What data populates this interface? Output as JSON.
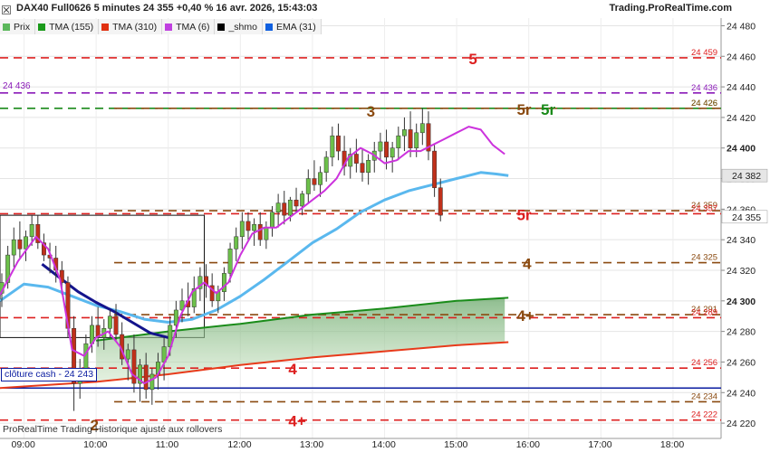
{
  "header": {
    "title": "DAX40 Full0626 5 minutes 24 355 +0,40 % 16 avr. 2026, 15:43:03",
    "brand": "Trading.ProRealTime.com"
  },
  "legend": [
    {
      "label": "Prix",
      "color": "#5cb85c"
    },
    {
      "label": "TMA (155)",
      "color": "#1a9a1a"
    },
    {
      "label": "TMA (310)",
      "color": "#e03010"
    },
    {
      "label": "TMA (6)",
      "color": "#c040e0"
    },
    {
      "label": "_shmo",
      "color": "#000000"
    },
    {
      "label": "EMA (31)",
      "color": "#1060e0"
    }
  ],
  "footer": "ProRealTime Trading  Historique ajusté aux rollovers",
  "cash": {
    "label": "clôture cash -  24 243",
    "value": 24243
  },
  "colors": {
    "bull": "#6cc04a",
    "bear": "#c0301a",
    "ema": "#5ab8ee",
    "tma6": "#cc33dd",
    "shmo": "#14148c",
    "tma155": "#1a8c1a",
    "tma310": "#e83a1a",
    "level_red": "#dd2020",
    "level_brown": "#8a4a10",
    "level_green": "#1a8a1a",
    "level_purple": "#8a1ab8",
    "cash_line": "#0a1ca0"
  },
  "chart_data": {
    "type": "candlestick",
    "title": "DAX40 Full0626 5 minutes",
    "xlabel": "",
    "ylabel": "",
    "ylim": [
      24210,
      24485
    ],
    "xlim": [
      "08:40",
      "18:40"
    ],
    "x_ticks": [
      "09:00",
      "10:00",
      "11:00",
      "12:00",
      "13:00",
      "14:00",
      "15:00",
      "16:00",
      "17:00",
      "18:00"
    ],
    "y_ticks": [
      24220,
      24240,
      24260,
      24280,
      24300,
      24320,
      24340,
      24360,
      24380,
      24400,
      24420,
      24440,
      24460,
      24480
    ],
    "y_ticks_bold": [
      24300,
      24400
    ],
    "last_price": {
      "label": "24 355",
      "value": 24355
    },
    "ema_marker": {
      "label": "24 382",
      "value": 24382
    },
    "levels": [
      {
        "value": 24459,
        "label": "24 459",
        "tag": "5",
        "color": "level_red",
        "style": "dash",
        "start": "08:40"
      },
      {
        "value": 24436,
        "label": "24 436",
        "tag": "",
        "color": "level_purple",
        "style": "dash",
        "start": "08:40",
        "left_label": "24 436"
      },
      {
        "value": 24426,
        "label": "24 426",
        "tag": "5r",
        "color": "level_green",
        "style": "dash",
        "start": "08:40"
      },
      {
        "value": 24426,
        "label": "24 426",
        "tag": "5r",
        "color": "level_brown",
        "style": "dash",
        "start": "10:15"
      },
      {
        "value": 24359,
        "label": "24 359",
        "tag": "",
        "color": "level_brown",
        "style": "dash",
        "start": "10:15"
      },
      {
        "value": 24357,
        "label": "24 357",
        "tag": "5r",
        "color": "level_red",
        "style": "dash",
        "start": "08:40"
      },
      {
        "value": 24325,
        "label": "24 325",
        "tag": "4",
        "color": "level_brown",
        "style": "dash",
        "start": "10:15"
      },
      {
        "value": 24291,
        "label": "24 291",
        "tag": "4+",
        "color": "level_brown",
        "style": "dash",
        "start": "10:15"
      },
      {
        "value": 24289,
        "label": "24 289",
        "tag": "",
        "color": "level_red",
        "style": "dash",
        "start": "08:40"
      },
      {
        "value": 24256,
        "label": "24 256",
        "tag": "4",
        "color": "level_red",
        "style": "dash",
        "start": "08:40"
      },
      {
        "value": 24234,
        "label": "24 234",
        "tag": "",
        "color": "level_brown",
        "style": "dash",
        "start": "10:15"
      },
      {
        "value": 24222,
        "label": "24 222",
        "tag": "4+",
        "color": "level_red",
        "style": "dash",
        "start": "08:40"
      }
    ],
    "annotations": [
      {
        "text": "3",
        "time": "13:45",
        "value": 24424,
        "color": "level_brown"
      },
      {
        "text": "2",
        "time": "09:55",
        "value": 24219,
        "color": "level_brown"
      }
    ],
    "box": {
      "start": "08:40",
      "end": "11:30",
      "top": 24356,
      "bottom": 24276
    },
    "series": [
      {
        "name": "Prix",
        "type": "ohlc",
        "start": "08:40",
        "interval_min": 5,
        "ohlc": [
          [
            24305,
            24318,
            24296,
            24312
          ],
          [
            24312,
            24336,
            24308,
            24330
          ],
          [
            24330,
            24348,
            24322,
            24340
          ],
          [
            24340,
            24352,
            24328,
            24334
          ],
          [
            24334,
            24346,
            24326,
            24342
          ],
          [
            24342,
            24356,
            24336,
            24350
          ],
          [
            24350,
            24356,
            24334,
            24338
          ],
          [
            24338,
            24344,
            24326,
            24330
          ],
          [
            24330,
            24338,
            24318,
            24328
          ],
          [
            24328,
            24336,
            24312,
            24320
          ],
          [
            24320,
            24326,
            24304,
            24312
          ],
          [
            24312,
            24316,
            24276,
            24282
          ],
          [
            24282,
            24290,
            24228,
            24246
          ],
          [
            24246,
            24262,
            24236,
            24256
          ],
          [
            24256,
            24278,
            24250,
            24272
          ],
          [
            24272,
            24290,
            24266,
            24284
          ],
          [
            24284,
            24296,
            24270,
            24276
          ],
          [
            24276,
            24288,
            24268,
            24282
          ],
          [
            24282,
            24294,
            24276,
            24290
          ],
          [
            24290,
            24298,
            24274,
            24278
          ],
          [
            24278,
            24286,
            24258,
            24262
          ],
          [
            24262,
            24272,
            24248,
            24268
          ],
          [
            24268,
            24278,
            24240,
            24246
          ],
          [
            24246,
            24262,
            24234,
            24258
          ],
          [
            24258,
            24266,
            24236,
            24242
          ],
          [
            24242,
            24256,
            24232,
            24252
          ],
          [
            24252,
            24266,
            24242,
            24260
          ],
          [
            24260,
            24276,
            24248,
            24270
          ],
          [
            24270,
            24290,
            24264,
            24284
          ],
          [
            24284,
            24300,
            24276,
            24294
          ],
          [
            24294,
            24308,
            24286,
            24300
          ],
          [
            24300,
            24312,
            24290,
            24296
          ],
          [
            24296,
            24316,
            24292,
            24308
          ],
          [
            24308,
            24322,
            24300,
            24316
          ],
          [
            24316,
            24324,
            24302,
            24310
          ],
          [
            24310,
            24318,
            24296,
            24300
          ],
          [
            24300,
            24310,
            24292,
            24306
          ],
          [
            24306,
            24322,
            24300,
            24318
          ],
          [
            24318,
            24338,
            24312,
            24334
          ],
          [
            24334,
            24348,
            24326,
            24342
          ],
          [
            24342,
            24358,
            24334,
            24352
          ],
          [
            24352,
            24358,
            24340,
            24346
          ],
          [
            24346,
            24354,
            24336,
            24350
          ],
          [
            24350,
            24358,
            24336,
            24340
          ],
          [
            24340,
            24352,
            24334,
            24348
          ],
          [
            24348,
            24362,
            24342,
            24358
          ],
          [
            24358,
            24370,
            24348,
            24364
          ],
          [
            24364,
            24372,
            24350,
            24356
          ],
          [
            24356,
            24368,
            24352,
            24366
          ],
          [
            24366,
            24374,
            24358,
            24362
          ],
          [
            24362,
            24372,
            24356,
            24370
          ],
          [
            24370,
            24386,
            24364,
            24380
          ],
          [
            24380,
            24392,
            24372,
            24376
          ],
          [
            24376,
            24388,
            24368,
            24384
          ],
          [
            24384,
            24398,
            24378,
            24394
          ],
          [
            24394,
            24414,
            24388,
            24408
          ],
          [
            24408,
            24416,
            24392,
            24398
          ],
          [
            24398,
            24408,
            24382,
            24388
          ],
          [
            24388,
            24400,
            24380,
            24396
          ],
          [
            24396,
            24406,
            24384,
            24390
          ],
          [
            24390,
            24400,
            24378,
            24384
          ],
          [
            24384,
            24396,
            24376,
            24392
          ],
          [
            24392,
            24404,
            24384,
            24398
          ],
          [
            24398,
            24410,
            24392,
            24404
          ],
          [
            24404,
            24412,
            24386,
            24394
          ],
          [
            24394,
            24404,
            24384,
            24400
          ],
          [
            24400,
            24414,
            24392,
            24408
          ],
          [
            24408,
            24420,
            24398,
            24412
          ],
          [
            24412,
            24424,
            24394,
            24400
          ],
          [
            24400,
            24416,
            24394,
            24410
          ],
          [
            24410,
            24426,
            24402,
            24416
          ],
          [
            24416,
            24424,
            24392,
            24398
          ],
          [
            24398,
            24402,
            24368,
            24374
          ],
          [
            24374,
            24380,
            24352,
            24356
          ]
        ]
      },
      {
        "name": "EMA (31)",
        "type": "line",
        "color": "ema",
        "points": [
          [
            "08:40",
            24300
          ],
          [
            "09:00",
            24311
          ],
          [
            "09:20",
            24309
          ],
          [
            "09:40",
            24303
          ],
          [
            "10:00",
            24297
          ],
          [
            "10:20",
            24293
          ],
          [
            "10:40",
            24288
          ],
          [
            "11:00",
            24286
          ],
          [
            "11:20",
            24288
          ],
          [
            "11:40",
            24294
          ],
          [
            "12:00",
            24303
          ],
          [
            "12:20",
            24314
          ],
          [
            "12:40",
            24326
          ],
          [
            "13:00",
            24338
          ],
          [
            "13:20",
            24347
          ],
          [
            "13:40",
            24358
          ],
          [
            "14:00",
            24366
          ],
          [
            "14:20",
            24372
          ],
          [
            "14:40",
            24376
          ],
          [
            "15:00",
            24380
          ],
          [
            "15:20",
            24384
          ],
          [
            "15:33",
            24383
          ],
          [
            "15:43",
            24382
          ]
        ]
      },
      {
        "name": "TMA (6)",
        "type": "line",
        "color": "tma6",
        "points": [
          [
            "08:40",
            24304
          ],
          [
            "08:55",
            24326
          ],
          [
            "09:10",
            24342
          ],
          [
            "09:20",
            24334
          ],
          [
            "09:30",
            24314
          ],
          [
            "09:40",
            24268
          ],
          [
            "09:50",
            24264
          ],
          [
            "10:00",
            24276
          ],
          [
            "10:10",
            24280
          ],
          [
            "10:20",
            24270
          ],
          [
            "10:30",
            24252
          ],
          [
            "10:40",
            24246
          ],
          [
            "10:50",
            24250
          ],
          [
            "11:00",
            24264
          ],
          [
            "11:10",
            24290
          ],
          [
            "11:20",
            24306
          ],
          [
            "11:30",
            24312
          ],
          [
            "11:40",
            24305
          ],
          [
            "11:50",
            24312
          ],
          [
            "12:00",
            24330
          ],
          [
            "12:10",
            24344
          ],
          [
            "12:20",
            24348
          ],
          [
            "12:30",
            24348
          ],
          [
            "12:40",
            24354
          ],
          [
            "12:50",
            24360
          ],
          [
            "13:00",
            24366
          ],
          [
            "13:10",
            24372
          ],
          [
            "13:20",
            24380
          ],
          [
            "13:30",
            24394
          ],
          [
            "13:40",
            24400
          ],
          [
            "13:50",
            24396
          ],
          [
            "14:00",
            24390
          ],
          [
            "14:10",
            24392
          ],
          [
            "14:20",
            24398
          ],
          [
            "14:30",
            24398
          ],
          [
            "14:40",
            24402
          ],
          [
            "14:50",
            24406
          ],
          [
            "15:00",
            24410
          ],
          [
            "15:10",
            24414
          ],
          [
            "15:20",
            24412
          ],
          [
            "15:30",
            24402
          ],
          [
            "15:40",
            24396
          ]
        ]
      },
      {
        "name": "_shmo",
        "type": "line",
        "color": "shmo",
        "points": [
          [
            "09:15",
            24324
          ],
          [
            "09:30",
            24315
          ],
          [
            "09:45",
            24306
          ],
          [
            "10:00",
            24299
          ],
          [
            "10:15",
            24293
          ],
          [
            "10:30",
            24286
          ],
          [
            "10:45",
            24279
          ],
          [
            "11:00",
            24276
          ]
        ]
      },
      {
        "name": "TMA (155)",
        "type": "line",
        "color": "tma155",
        "points": [
          [
            "10:00",
            24274
          ],
          [
            "11:00",
            24280
          ],
          [
            "12:00",
            24285
          ],
          [
            "13:00",
            24291
          ],
          [
            "14:00",
            24295
          ],
          [
            "15:00",
            24300
          ],
          [
            "15:43",
            24302
          ]
        ]
      },
      {
        "name": "TMA (310)",
        "type": "line",
        "color": "tma310",
        "points": [
          [
            "08:40",
            24243
          ],
          [
            "09:00",
            24244
          ],
          [
            "10:00",
            24247
          ],
          [
            "11:00",
            24252
          ],
          [
            "12:00",
            24258
          ],
          [
            "13:00",
            24263
          ],
          [
            "14:00",
            24267
          ],
          [
            "15:00",
            24271
          ],
          [
            "15:43",
            24273
          ]
        ]
      }
    ],
    "cash_close": 24243
  }
}
